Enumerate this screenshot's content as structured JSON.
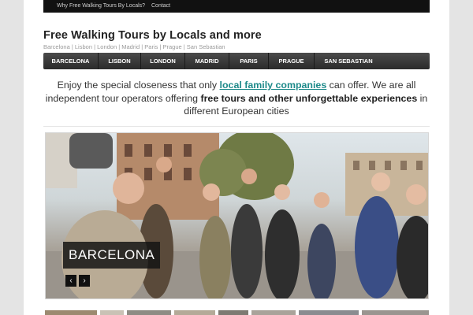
{
  "topbar": {
    "links": [
      "Why Free Walking Tours By Locals?",
      "Contact"
    ]
  },
  "header": {
    "title": "Free Walking Tours by Locals and more",
    "tagline": "Barcelona | Lisbon | London | Madrid | Paris | Prague | San Sebastian"
  },
  "nav": {
    "items": [
      "BARCELONA",
      "LISBON",
      "LONDON",
      "MADRID",
      "PARIS",
      "PRAGUE",
      "SAN SEBASTIAN"
    ]
  },
  "intro": {
    "part1": "Enjoy the special closeness that only ",
    "link": "local family companies",
    "part2": " can offer. We are all independent tour operators offering ",
    "bold": "free tours and other unforgettable experiences",
    "part3": " in different European cities"
  },
  "slider": {
    "caption": "BARCELONA",
    "prev_icon": "chevron-left-icon",
    "next_icon": "chevron-right-icon",
    "prev_glyph": "‹",
    "next_glyph": "›"
  },
  "colors": {
    "nav_bg": "#3a3a3a",
    "topbar_bg": "#111111",
    "link": "#1e8a8a",
    "page_bg": "#e4e4e4"
  }
}
